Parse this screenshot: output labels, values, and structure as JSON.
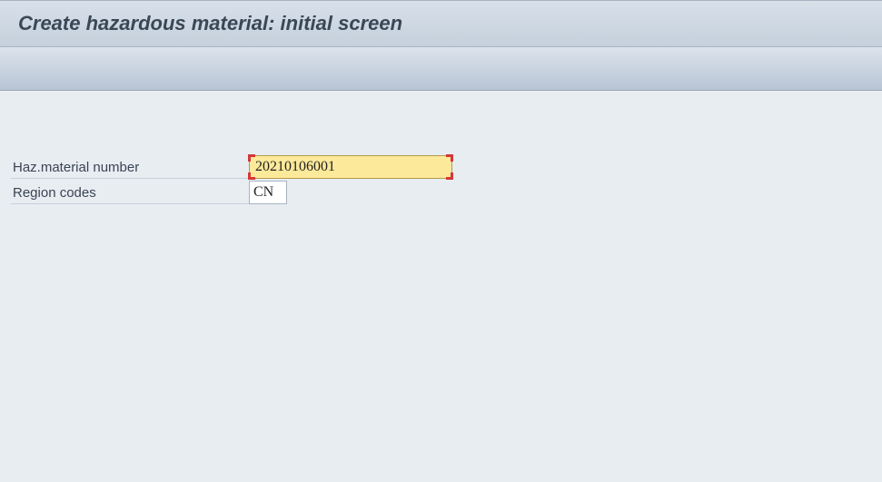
{
  "header": {
    "title": "Create hazardous material: initial screen"
  },
  "form": {
    "haz_material_label": "Haz.material number",
    "haz_material_value": "20210106001",
    "region_codes_label": "Region codes",
    "region_codes_value": "CN"
  }
}
